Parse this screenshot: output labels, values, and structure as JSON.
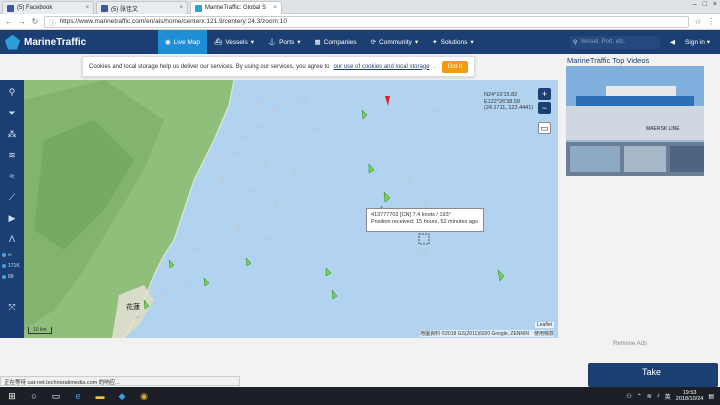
{
  "browser": {
    "tabs": [
      {
        "label": "(5) Facebook",
        "color": "#3b5998"
      },
      {
        "label": "(5) 张佳文",
        "color": "#3b5998"
      },
      {
        "label": "MarineTraffic: Global S",
        "color": "#2a9fd8"
      }
    ],
    "url": "https://www.marinetraffic.com/en/ais/home/centerx:121.9/centery:24.3/zoom:10"
  },
  "header": {
    "logo": "MarineTraffic",
    "menu": [
      {
        "label": "Live Map",
        "icon": "compass-icon"
      },
      {
        "label": "Vessels",
        "icon": "ship-icon"
      },
      {
        "label": "Ports",
        "icon": "anchor-icon"
      },
      {
        "label": "Companies",
        "icon": "building-icon"
      },
      {
        "label": "Community",
        "icon": "refresh-icon"
      },
      {
        "label": "Solutions",
        "icon": "bulb-icon"
      }
    ],
    "search_placeholder": "Vessel, Port, etc.",
    "signin": "Sign in"
  },
  "cookie": {
    "text": "Cookies and local storage help us deliver our services. By using our services, you agree to",
    "link": "our use of cookies and local storage",
    "button": "Got it"
  },
  "toolbar": {
    "counts": [
      {
        "label": "∞"
      },
      {
        "label": "171K"
      },
      {
        "label": "89"
      }
    ]
  },
  "map": {
    "coords": [
      "N24°10'15.82",
      "E122°26'38.59",
      "(24.1711, 122.4441)"
    ],
    "zoom_in": "+",
    "zoom_out": "−",
    "tooltip_title": "413777702 [CN] 7.4 knots / 193°",
    "tooltip_sub": "Position received: 15 hours, 52 minutes ago",
    "place_label": "花蓮",
    "attribution": "地圖資料 ©2018 GS(2011)6020 Google, ZENRIN　使用條款",
    "leaflet": "Leaflet",
    "scale": "10 km"
  },
  "right_panel": {
    "title": "MarineTraffic Top Videos",
    "video_label": "MAERSK LINE",
    "remove_ads": "Remove Ads",
    "take": "Take"
  },
  "status_text": "正在等待 uat-net.technoratimedia.com 的响应...",
  "taskbar": {
    "time": "19:53",
    "date": "2018/10/24",
    "lang": "英"
  },
  "colors": {
    "header": "#1b3f73",
    "accent": "#1e8ed6",
    "sea": "#b2d3f0",
    "land": "#8fbf7a",
    "vessel_cargo": "#6cd84c",
    "vessel_red": "#e02020",
    "cookie_button": "#f39c12"
  }
}
